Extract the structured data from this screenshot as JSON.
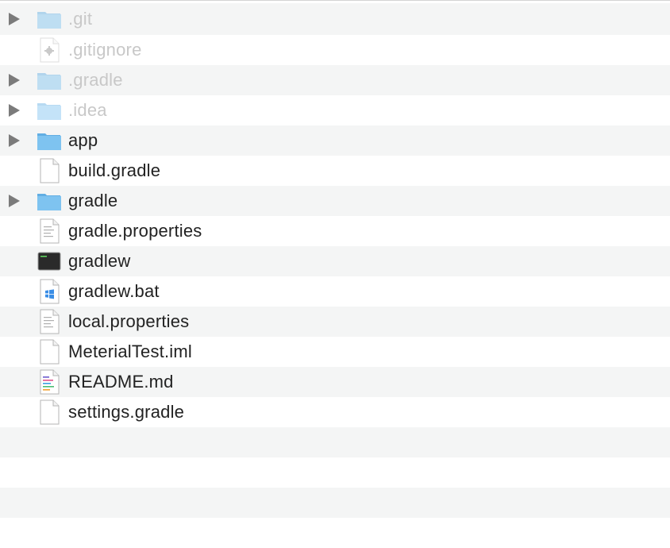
{
  "files": [
    {
      "name": ".git",
      "type": "folder",
      "hidden": true,
      "expandable": true,
      "icon": "folder-icon"
    },
    {
      "name": ".gitignore",
      "type": "config",
      "hidden": true,
      "expandable": false,
      "icon": "gear-file-icon"
    },
    {
      "name": ".gradle",
      "type": "folder",
      "hidden": true,
      "expandable": true,
      "icon": "folder-icon"
    },
    {
      "name": ".idea",
      "type": "folder",
      "hidden": true,
      "expandable": true,
      "icon": "folder-icon"
    },
    {
      "name": "app",
      "type": "folder",
      "hidden": false,
      "expandable": true,
      "icon": "folder-icon"
    },
    {
      "name": "build.gradle",
      "type": "file",
      "hidden": false,
      "expandable": false,
      "icon": "document-icon"
    },
    {
      "name": "gradle",
      "type": "folder",
      "hidden": false,
      "expandable": true,
      "icon": "folder-icon"
    },
    {
      "name": "gradle.properties",
      "type": "text",
      "hidden": false,
      "expandable": false,
      "icon": "text-document-icon"
    },
    {
      "name": "gradlew",
      "type": "exec",
      "hidden": false,
      "expandable": false,
      "icon": "terminal-icon"
    },
    {
      "name": "gradlew.bat",
      "type": "bat",
      "hidden": false,
      "expandable": false,
      "icon": "windows-file-icon"
    },
    {
      "name": "local.properties",
      "type": "text",
      "hidden": false,
      "expandable": false,
      "icon": "text-document-icon"
    },
    {
      "name": "MeterialTest.iml",
      "type": "file",
      "hidden": false,
      "expandable": false,
      "icon": "document-icon"
    },
    {
      "name": "README.md",
      "type": "markdown",
      "hidden": false,
      "expandable": false,
      "icon": "markdown-document-icon"
    },
    {
      "name": "settings.gradle",
      "type": "file",
      "hidden": false,
      "expandable": false,
      "icon": "document-icon"
    }
  ],
  "colors": {
    "folder": "#7ec3f0",
    "folder_tab": "#62aee3",
    "hidden_text": "#c8c8c8",
    "text": "#222222",
    "stripe": "#f4f5f5"
  }
}
